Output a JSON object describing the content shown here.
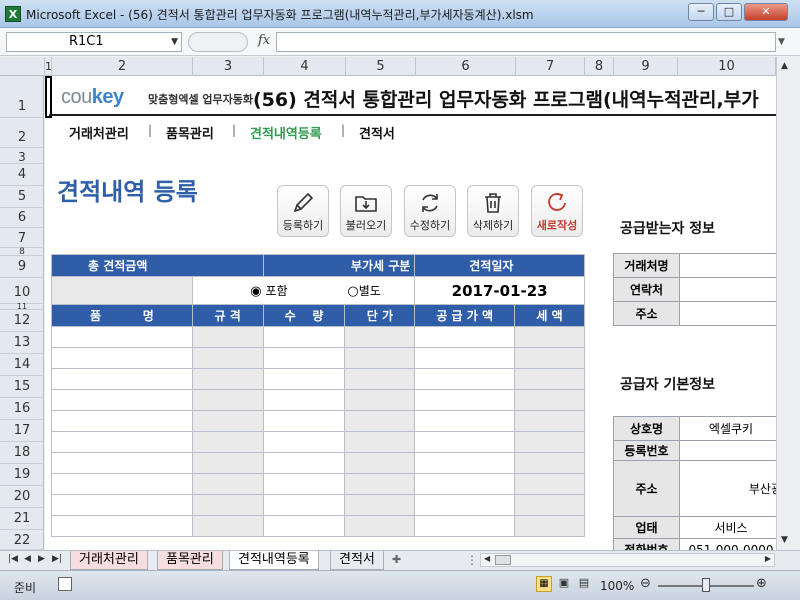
{
  "window": {
    "title": "Microsoft Excel - (56) 견적서 통합관리 업무자동화 프로그램(내역누적관리,부가세자동계산).xlsm",
    "min": "─",
    "max": "□",
    "close": "✕"
  },
  "formula_bar": {
    "name_box": "R1C1",
    "fx": "fx"
  },
  "columns": [
    "1",
    "2",
    "3",
    "4",
    "5",
    "6",
    "7",
    "8",
    "9",
    "10"
  ],
  "rows": [
    "1",
    "2",
    "3",
    "4",
    "5",
    "6",
    "7",
    "8",
    "9",
    "10",
    "11",
    "12",
    "13",
    "14",
    "15",
    "16",
    "17",
    "18",
    "19",
    "20",
    "21",
    "22"
  ],
  "header": {
    "logo_main": "cou",
    "logo_accent": "key",
    "logo_sub": "맞춤형엑셀 업무자동화",
    "title": "(56) 견적서 통합관리 업무자동화 프로그램(내역누적관리,부가"
  },
  "nav": [
    "거래처관리",
    "품목관리",
    "견적내역등록",
    "견적서"
  ],
  "page_title": "견적내역 등록",
  "toolbar": {
    "register": "등록하기",
    "load": "불러오기",
    "modify": "수정하기",
    "delete": "삭제하기",
    "new": "새로작성"
  },
  "summary": {
    "total_label": "총 견적금액",
    "vat_label": "부가세 구분",
    "date_label": "견적일자",
    "vat_included": "포함",
    "vat_separate": "별도",
    "date_value": "2017-01-23"
  },
  "item_table": {
    "headers": [
      "품          명",
      "규 격",
      "수    량",
      "단 가",
      "공 급 가 액",
      "세 액"
    ]
  },
  "receiver": {
    "title": "공급받는자 정보",
    "rows": [
      {
        "k": "거래처명",
        "v": ""
      },
      {
        "k": "연락처",
        "v": ""
      },
      {
        "k": "주소",
        "v": ""
      }
    ]
  },
  "supplier": {
    "title": "공급자 기본정보",
    "company_label": "상호명",
    "company": "엑셀쿠키",
    "reg_label": "등록번호",
    "reg": "",
    "addr_label": "주소",
    "addr": "부산광",
    "biz_label": "업태",
    "biz": "서비스",
    "phone_label": "전화번호",
    "phone": "051-000-0000"
  },
  "sheet_tabs": [
    "거래처관리",
    "품목관리",
    "견적내역등록",
    "견적서"
  ],
  "status": {
    "ready": "준비",
    "zoom": "100%",
    "zoom_level": 1.0
  },
  "colors": {
    "accent": "#2f5da8",
    "nav_active": "#2f9b4f",
    "title": "#2e5fa8"
  }
}
